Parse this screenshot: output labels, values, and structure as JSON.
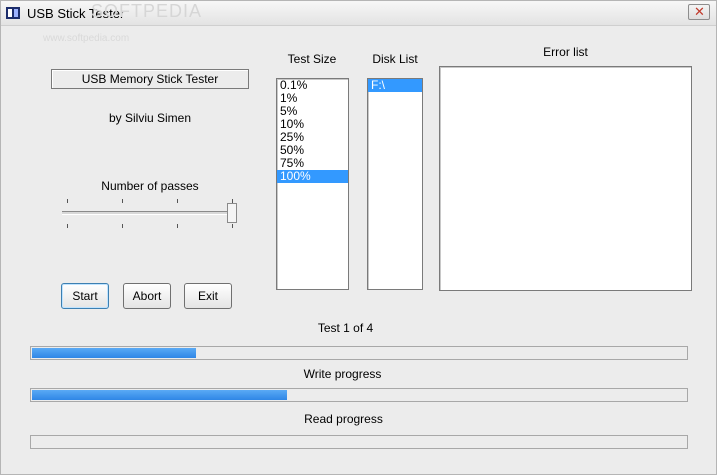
{
  "window": {
    "title": "USB Stick Tester",
    "watermark": "SOFTPEDIA",
    "watermark_url": "www.softpedia.com"
  },
  "info": {
    "app_name": "USB Memory Stick Tester",
    "author": "by Silviu Simen",
    "passes_label": "Number of passes",
    "passes_value": 4,
    "passes_max": 4
  },
  "buttons": {
    "start": "Start",
    "abort": "Abort",
    "exit": "Exit"
  },
  "test_size": {
    "label": "Test Size",
    "items": [
      "0.1%",
      "1%",
      "5%",
      "10%",
      "25%",
      "50%",
      "75%",
      "100%"
    ],
    "selected_index": 7
  },
  "disk_list": {
    "label": "Disk List",
    "items": [
      "F:\\"
    ],
    "selected_index": 0
  },
  "error_list": {
    "label": "Error list",
    "items": []
  },
  "status": {
    "test_counter": "Test 1 of 4",
    "progress_overall": 0.25,
    "write_label": "Write progress",
    "write_progress": 0.39,
    "read_label": "Read progress",
    "read_progress": 0.0
  },
  "colors": {
    "selection": "#3399ff",
    "progress_fill": "#2f86e6"
  }
}
